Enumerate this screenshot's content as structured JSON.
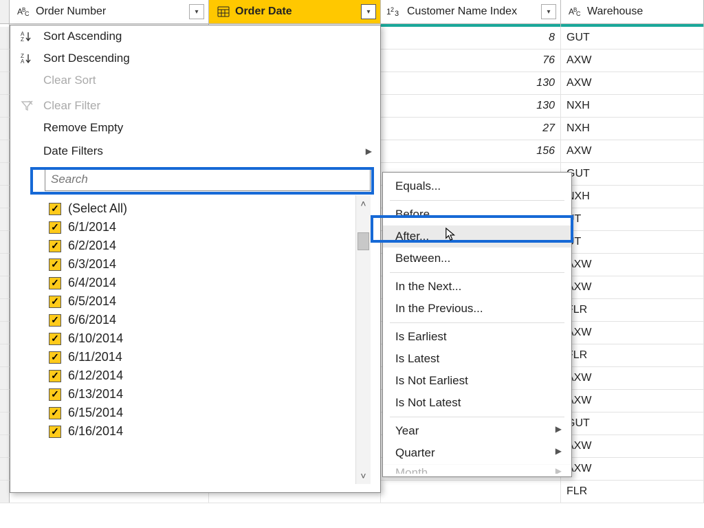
{
  "columns": {
    "order_number": {
      "label": "Order Number"
    },
    "order_date": {
      "label": "Order Date"
    },
    "customer_name_index": {
      "label": "Customer Name Index"
    },
    "warehouse": {
      "label": "Warehouse"
    }
  },
  "rows": [
    {
      "customer_name_index": "8",
      "warehouse": "GUT"
    },
    {
      "customer_name_index": "76",
      "warehouse": "AXW"
    },
    {
      "customer_name_index": "130",
      "warehouse": "AXW"
    },
    {
      "customer_name_index": "130",
      "warehouse": "NXH"
    },
    {
      "customer_name_index": "27",
      "warehouse": "NXH"
    },
    {
      "customer_name_index": "156",
      "warehouse": "AXW"
    },
    {
      "customer_name_index": "",
      "warehouse": "GUT"
    },
    {
      "customer_name_index": "",
      "warehouse": "NXH"
    },
    {
      "customer_name_index": "",
      "warehouse": "UT"
    },
    {
      "customer_name_index": "",
      "warehouse": "UT"
    },
    {
      "customer_name_index": "",
      "warehouse": "AXW"
    },
    {
      "customer_name_index": "",
      "warehouse": "AXW"
    },
    {
      "customer_name_index": "",
      "warehouse": "FLR"
    },
    {
      "customer_name_index": "",
      "warehouse": "AXW"
    },
    {
      "customer_name_index": "",
      "warehouse": "FLR"
    },
    {
      "customer_name_index": "",
      "warehouse": "AXW"
    },
    {
      "customer_name_index": "",
      "warehouse": "AXW"
    },
    {
      "customer_name_index": "",
      "warehouse": "GUT"
    },
    {
      "customer_name_index": "",
      "warehouse": "AXW"
    },
    {
      "customer_name_index": "",
      "warehouse": "AXW"
    },
    {
      "customer_name_index": "",
      "warehouse": "FLR"
    }
  ],
  "dropdown": {
    "sort_asc": "Sort Ascending",
    "sort_desc": "Sort Descending",
    "clear_sort": "Clear Sort",
    "clear_filter": "Clear Filter",
    "remove_empty": "Remove Empty",
    "date_filters": "Date Filters",
    "search_placeholder": "Search",
    "values": [
      "(Select All)",
      "6/1/2014",
      "6/2/2014",
      "6/3/2014",
      "6/4/2014",
      "6/5/2014",
      "6/6/2014",
      "6/10/2014",
      "6/11/2014",
      "6/12/2014",
      "6/13/2014",
      "6/15/2014",
      "6/16/2014"
    ]
  },
  "submenu": {
    "equals": "Equals...",
    "before": "Before...",
    "after": "After...",
    "between": "Between...",
    "in_next": "In the Next...",
    "in_prev": "In the Previous...",
    "is_earliest": "Is Earliest",
    "is_latest": "Is Latest",
    "is_not_earliest": "Is Not Earliest",
    "is_not_latest": "Is Not Latest",
    "year": "Year",
    "quarter": "Quarter",
    "month": "Month"
  }
}
